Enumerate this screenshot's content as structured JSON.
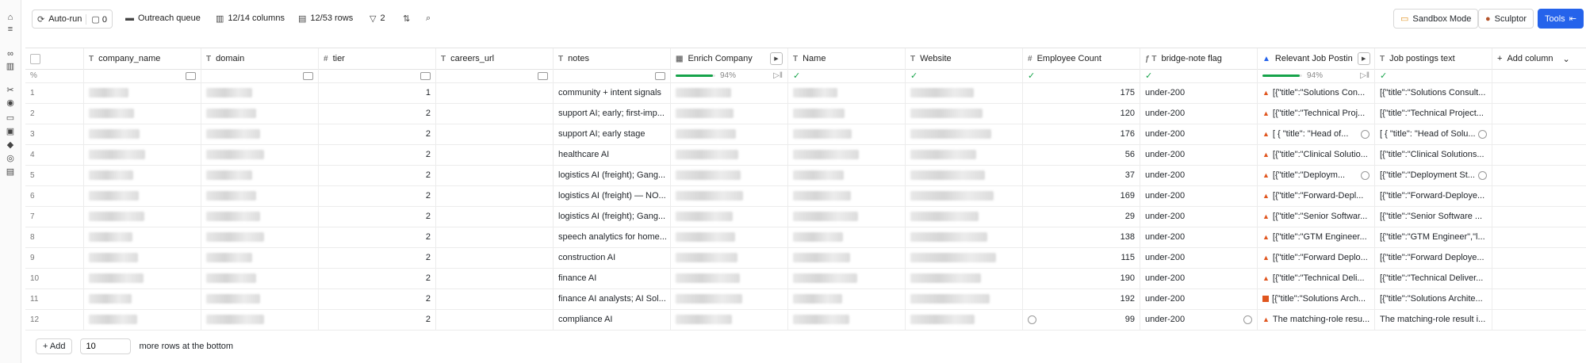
{
  "toolbar": {
    "autorun_label": "Auto-run",
    "autorun_count": "0",
    "queue_label": "Outreach queue",
    "columns_label": "12/14 columns",
    "rows_label": "12/53 rows",
    "filter_count": "2",
    "sandbox_label": "Sandbox Mode",
    "sculptor_label": "Sculptor",
    "tools_label": "Tools"
  },
  "columns": [
    {
      "icon": "T",
      "label": "company_name"
    },
    {
      "icon": "T",
      "label": "domain"
    },
    {
      "icon": "#",
      "label": "tier"
    },
    {
      "icon": "T",
      "label": "careers_url"
    },
    {
      "icon": "T",
      "label": "notes"
    },
    {
      "icon": "▦",
      "label": "Enrich Company"
    },
    {
      "icon": "T",
      "label": "Name"
    },
    {
      "icon": "T",
      "label": "Website"
    },
    {
      "icon": "#",
      "label": "Employee Count"
    },
    {
      "icon": "ƒ T",
      "label": "bridge-note flag"
    },
    {
      "icon": "▲",
      "label": "Relevant Job Postin"
    },
    {
      "icon": "T",
      "label": "Job postings text"
    },
    {
      "icon": "+",
      "label": "Add column"
    }
  ],
  "subheader": {
    "rownum_label": "%",
    "enrich_percent": "94%",
    "relevant_percent": "94%",
    "enrich_progress": 0.94,
    "relevant_progress": 0.94
  },
  "rows": [
    {
      "n": "1",
      "tier": "1",
      "notes": "community + intent signals",
      "emp": "175",
      "flag": "under-200",
      "rel": "[{\"title\":\"Solutions Con...",
      "job": "[{\"title\":\"Solutions Consult..."
    },
    {
      "n": "2",
      "tier": "2",
      "notes": "support AI; early; first-imp...",
      "emp": "120",
      "flag": "under-200",
      "rel": "[{\"title\":\"Technical Proj...",
      "job": "[{\"title\":\"Technical Project..."
    },
    {
      "n": "3",
      "tier": "2",
      "notes": "support AI; early stage",
      "emp": "176",
      "flag": "under-200",
      "rel": "[ { \"title\": \"Head of...",
      "job": "[ { \"title\": \"Head of Solu..."
    },
    {
      "n": "4",
      "tier": "2",
      "notes": "healthcare AI",
      "emp": "56",
      "flag": "under-200",
      "rel": "[{\"title\":\"Clinical Solutio...",
      "job": "[{\"title\":\"Clinical Solutions..."
    },
    {
      "n": "5",
      "tier": "2",
      "notes": "logistics AI (freight); Gang...",
      "emp": "37",
      "flag": "under-200",
      "rel": "[{\"title\":\"Deploym...",
      "job": "[{\"title\":\"Deployment St..."
    },
    {
      "n": "6",
      "tier": "2",
      "notes": "logistics AI (freight) — NO...",
      "emp": "169",
      "flag": "under-200",
      "rel": "[{\"title\":\"Forward-Depl...",
      "job": "[{\"title\":\"Forward-Deploye..."
    },
    {
      "n": "7",
      "tier": "2",
      "notes": "logistics AI (freight); Gang...",
      "emp": "29",
      "flag": "under-200",
      "rel": "[{\"title\":\"Senior Softwar...",
      "job": "[{\"title\":\"Senior Software ..."
    },
    {
      "n": "8",
      "tier": "2",
      "notes": "speech analytics for home...",
      "emp": "138",
      "flag": "under-200",
      "rel": "[{\"title\":\"GTM Engineer...",
      "job": "[{\"title\":\"GTM Engineer\",\"l..."
    },
    {
      "n": "9",
      "tier": "2",
      "notes": "construction AI",
      "emp": "115",
      "flag": "under-200",
      "rel": "[{\"title\":\"Forward Deplo...",
      "job": "[{\"title\":\"Forward Deploye..."
    },
    {
      "n": "10",
      "tier": "2",
      "notes": "finance AI",
      "emp": "190",
      "flag": "under-200",
      "rel": "[{\"title\":\"Technical Deli...",
      "job": "[{\"title\":\"Technical Deliver..."
    },
    {
      "n": "11",
      "tier": "2",
      "notes": "finance AI analysts; AI Sol...",
      "emp": "192",
      "flag": "under-200",
      "rel": "[{\"title\":\"Solutions Arch...",
      "job": "[{\"title\":\"Solutions Archite..."
    },
    {
      "n": "12",
      "tier": "2",
      "notes": "compliance AI",
      "emp": "99",
      "flag": "under-200",
      "rel": "The matching-role resu...",
      "job": "The matching-role result i..."
    }
  ],
  "footer": {
    "add_label": "Add",
    "rows_value": "10",
    "suffix": "more rows at the bottom"
  },
  "colors": {
    "accent": "#2563eb",
    "progress": "#16a34a",
    "warning": "#e0561f"
  }
}
